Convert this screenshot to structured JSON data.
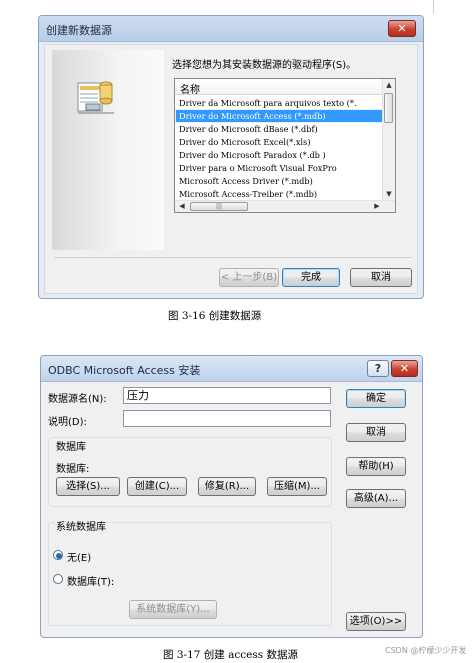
{
  "dialog1": {
    "title": "创建新数据源",
    "close_glyph": "✕",
    "prompt": "选择您想为其安装数据源的驱动程序(S)。",
    "list_header": "名称",
    "drivers": [
      "Driver da Microsoft para arquivos texto (*.",
      "Driver do Microsoft Access (*.mdb)",
      "Driver do Microsoft dBase (*.dbf)",
      "Driver do Microsoft Excel(*.xls)",
      "Driver do Microsoft Paradox (*.db )",
      "Driver para o Microsoft Visual FoxPro",
      "Microsoft Access Driver (*.mdb)",
      "Microsoft Access-Treiber (*.mdb)"
    ],
    "selected_index": 1,
    "back_button": "< 上一步(B)",
    "finish_button": "完成",
    "cancel_button": "取消",
    "caption": "图 3-16 创建数据源"
  },
  "dialog2": {
    "title": "ODBC Microsoft Access 安装",
    "help_glyph": "?",
    "close_glyph": "✕",
    "dsn_label": "数据源名(N):",
    "dsn_value": "压力",
    "desc_label": "说明(D):",
    "desc_value": "",
    "db_group": "数据库",
    "db_label": "数据库:",
    "select_button": "选择(S)...",
    "create_button": "创建(C)...",
    "repair_button": "修复(R)...",
    "compact_button": "压缩(M)...",
    "sysdb_group": "系统数据库",
    "none_radio": "无(E)",
    "db_radio": "数据库(T):",
    "sysdb_button": "系统数据库(Y)...",
    "ok_button": "确定",
    "cancel_button": "取消",
    "help_button": "帮助(H)",
    "advanced_button": "高级(A)...",
    "options_button": "选项(O)>>",
    "caption": "图 3-17 创建 access 数据源",
    "watermark": "CSDN @柠檬少少开发"
  }
}
